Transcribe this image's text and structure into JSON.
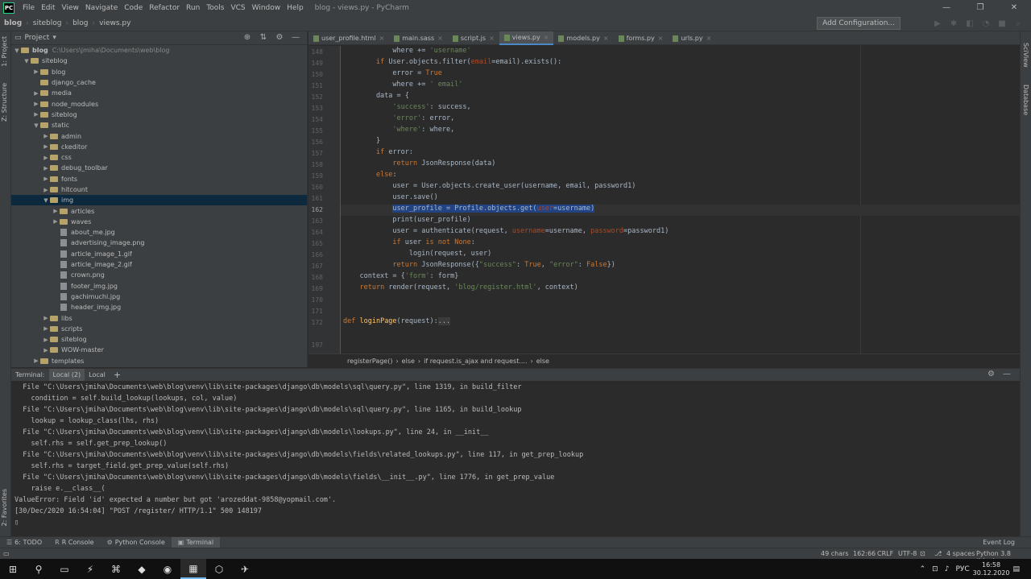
{
  "window": {
    "title": "blog - views.py - PyCharm",
    "menu": [
      "File",
      "Edit",
      "View",
      "Navigate",
      "Code",
      "Refactor",
      "Run",
      "Tools",
      "VCS",
      "Window",
      "Help"
    ],
    "controls": [
      "—",
      "❐",
      "✕"
    ]
  },
  "navbar": {
    "breadcrumbs": [
      "blog",
      "siteblog",
      "blog",
      "views.py"
    ],
    "add_configuration": "Add Configuration..."
  },
  "left_strip": {
    "project": "1: Project",
    "structure": "Z: Structure",
    "favorites": "2: Favorites"
  },
  "right_strip": {
    "sciview": "SciView",
    "database": "Database"
  },
  "project": {
    "header": "Project",
    "tree": [
      {
        "label": "blog",
        "path": "C:\\Users\\jmiha\\Documents\\web\\blog",
        "level": 0,
        "type": "folder",
        "open": true,
        "bold": true
      },
      {
        "label": "siteblog",
        "level": 1,
        "type": "folder",
        "open": true
      },
      {
        "label": "blog",
        "level": 2,
        "type": "folder",
        "open": false
      },
      {
        "label": "django_cache",
        "level": 2,
        "type": "folder",
        "open": null
      },
      {
        "label": "media",
        "level": 2,
        "type": "folder",
        "open": false
      },
      {
        "label": "node_modules",
        "level": 2,
        "type": "folder",
        "open": false
      },
      {
        "label": "siteblog",
        "level": 2,
        "type": "folder",
        "open": false
      },
      {
        "label": "static",
        "level": 2,
        "type": "folder",
        "open": true
      },
      {
        "label": "admin",
        "level": 3,
        "type": "folder",
        "open": false
      },
      {
        "label": "ckeditor",
        "level": 3,
        "type": "folder",
        "open": false
      },
      {
        "label": "css",
        "level": 3,
        "type": "folder",
        "open": false
      },
      {
        "label": "debug_toolbar",
        "level": 3,
        "type": "folder",
        "open": false
      },
      {
        "label": "fonts",
        "level": 3,
        "type": "folder",
        "open": false
      },
      {
        "label": "hitcount",
        "level": 3,
        "type": "folder",
        "open": false
      },
      {
        "label": "img",
        "level": 3,
        "type": "folder",
        "open": true,
        "selected": true
      },
      {
        "label": "articles",
        "level": 4,
        "type": "folder",
        "open": false
      },
      {
        "label": "waves",
        "level": 4,
        "type": "folder",
        "open": false
      },
      {
        "label": "about_me.jpg",
        "level": 4,
        "type": "file"
      },
      {
        "label": "advertising_image.png",
        "level": 4,
        "type": "file"
      },
      {
        "label": "article_image_1.gif",
        "level": 4,
        "type": "file"
      },
      {
        "label": "article_image_2.gif",
        "level": 4,
        "type": "file"
      },
      {
        "label": "crown.png",
        "level": 4,
        "type": "file"
      },
      {
        "label": "footer_img.jpg",
        "level": 4,
        "type": "file"
      },
      {
        "label": "gachimuchi.jpg",
        "level": 4,
        "type": "file"
      },
      {
        "label": "header_img.jpg",
        "level": 4,
        "type": "file"
      },
      {
        "label": "libs",
        "level": 3,
        "type": "folder",
        "open": false
      },
      {
        "label": "scripts",
        "level": 3,
        "type": "folder",
        "open": false
      },
      {
        "label": "siteblog",
        "level": 3,
        "type": "folder",
        "open": false
      },
      {
        "label": "WOW-master",
        "level": 3,
        "type": "folder",
        "open": false
      },
      {
        "label": "templates",
        "level": 2,
        "type": "folder",
        "open": false
      }
    ]
  },
  "editor": {
    "tabs": [
      {
        "label": "user_profile.html",
        "active": false
      },
      {
        "label": "main.sass",
        "active": false
      },
      {
        "label": "script.js",
        "active": false
      },
      {
        "label": "views.py",
        "active": true
      },
      {
        "label": "models.py",
        "active": false
      },
      {
        "label": "forms.py",
        "active": false
      },
      {
        "label": "urls.py",
        "active": false
      }
    ],
    "line_numbers": [
      "148",
      "149",
      "150",
      "151",
      "152",
      "153",
      "154",
      "155",
      "156",
      "157",
      "158",
      "159",
      "160",
      "161",
      "162",
      "163",
      "164",
      "165",
      "166",
      "167",
      "168",
      "169",
      "170",
      "171",
      "172",
      "197"
    ],
    "current_line": "162",
    "breadcrumbs": [
      "registerPage()",
      "›",
      "else",
      "›",
      "if request.is_ajax and request....",
      "›",
      "else"
    ]
  },
  "terminal": {
    "label": "Terminal:",
    "tabs": [
      "Local (2)",
      "Local"
    ],
    "add": "+",
    "lines": [
      "  File \"C:\\Users\\jmiha\\Documents\\web\\blog\\venv\\lib\\site-packages\\django\\db\\models\\sql\\query.py\", line 1319, in build_filter",
      "    condition = self.build_lookup(lookups, col, value)",
      "  File \"C:\\Users\\jmiha\\Documents\\web\\blog\\venv\\lib\\site-packages\\django\\db\\models\\sql\\query.py\", line 1165, in build_lookup",
      "    lookup = lookup_class(lhs, rhs)",
      "  File \"C:\\Users\\jmiha\\Documents\\web\\blog\\venv\\lib\\site-packages\\django\\db\\models\\lookups.py\", line 24, in __init__",
      "    self.rhs = self.get_prep_lookup()",
      "  File \"C:\\Users\\jmiha\\Documents\\web\\blog\\venv\\lib\\site-packages\\django\\db\\models\\fields\\related_lookups.py\", line 117, in get_prep_lookup",
      "    self.rhs = target_field.get_prep_value(self.rhs)",
      "  File \"C:\\Users\\jmiha\\Documents\\web\\blog\\venv\\lib\\site-packages\\django\\db\\models\\fields\\__init__.py\", line 1776, in get_prep_value",
      "    raise e.__class__(",
      "ValueError: Field 'id' expected a number but got 'arozeddat-9858@yopmail.com'.",
      "[30/Dec/2020 16:54:04] \"POST /register/ HTTP/1.1\" 500 148197",
      "▯"
    ]
  },
  "toolwindows": {
    "items": [
      {
        "label": "6: TODO",
        "icon": "☰",
        "active": false
      },
      {
        "label": "R Console",
        "icon": "R",
        "active": false
      },
      {
        "label": "Python Console",
        "icon": "⚙",
        "active": false
      },
      {
        "label": "Terminal",
        "icon": "▣",
        "active": true
      }
    ],
    "event_log": "Event Log"
  },
  "status": {
    "chars": "49 chars",
    "position": "162:66",
    "line_sep": "CRLF",
    "encoding": "UTF-8",
    "indent": "4 spaces",
    "interpreter": "Python 3.8 (blog)"
  },
  "taskbar": {
    "apps": [
      "⊞",
      "⚲",
      "▭",
      "⚡",
      "⌘",
      "◆",
      "◉",
      "▦",
      "⬡",
      "✈"
    ],
    "tray_language": "РУС",
    "time": "16:58",
    "date": "30.12.2020"
  },
  "colors": {
    "accent": "#4a88c7",
    "selection": "#214283",
    "background": "#2b2b2b",
    "panel": "#3c3f41"
  }
}
